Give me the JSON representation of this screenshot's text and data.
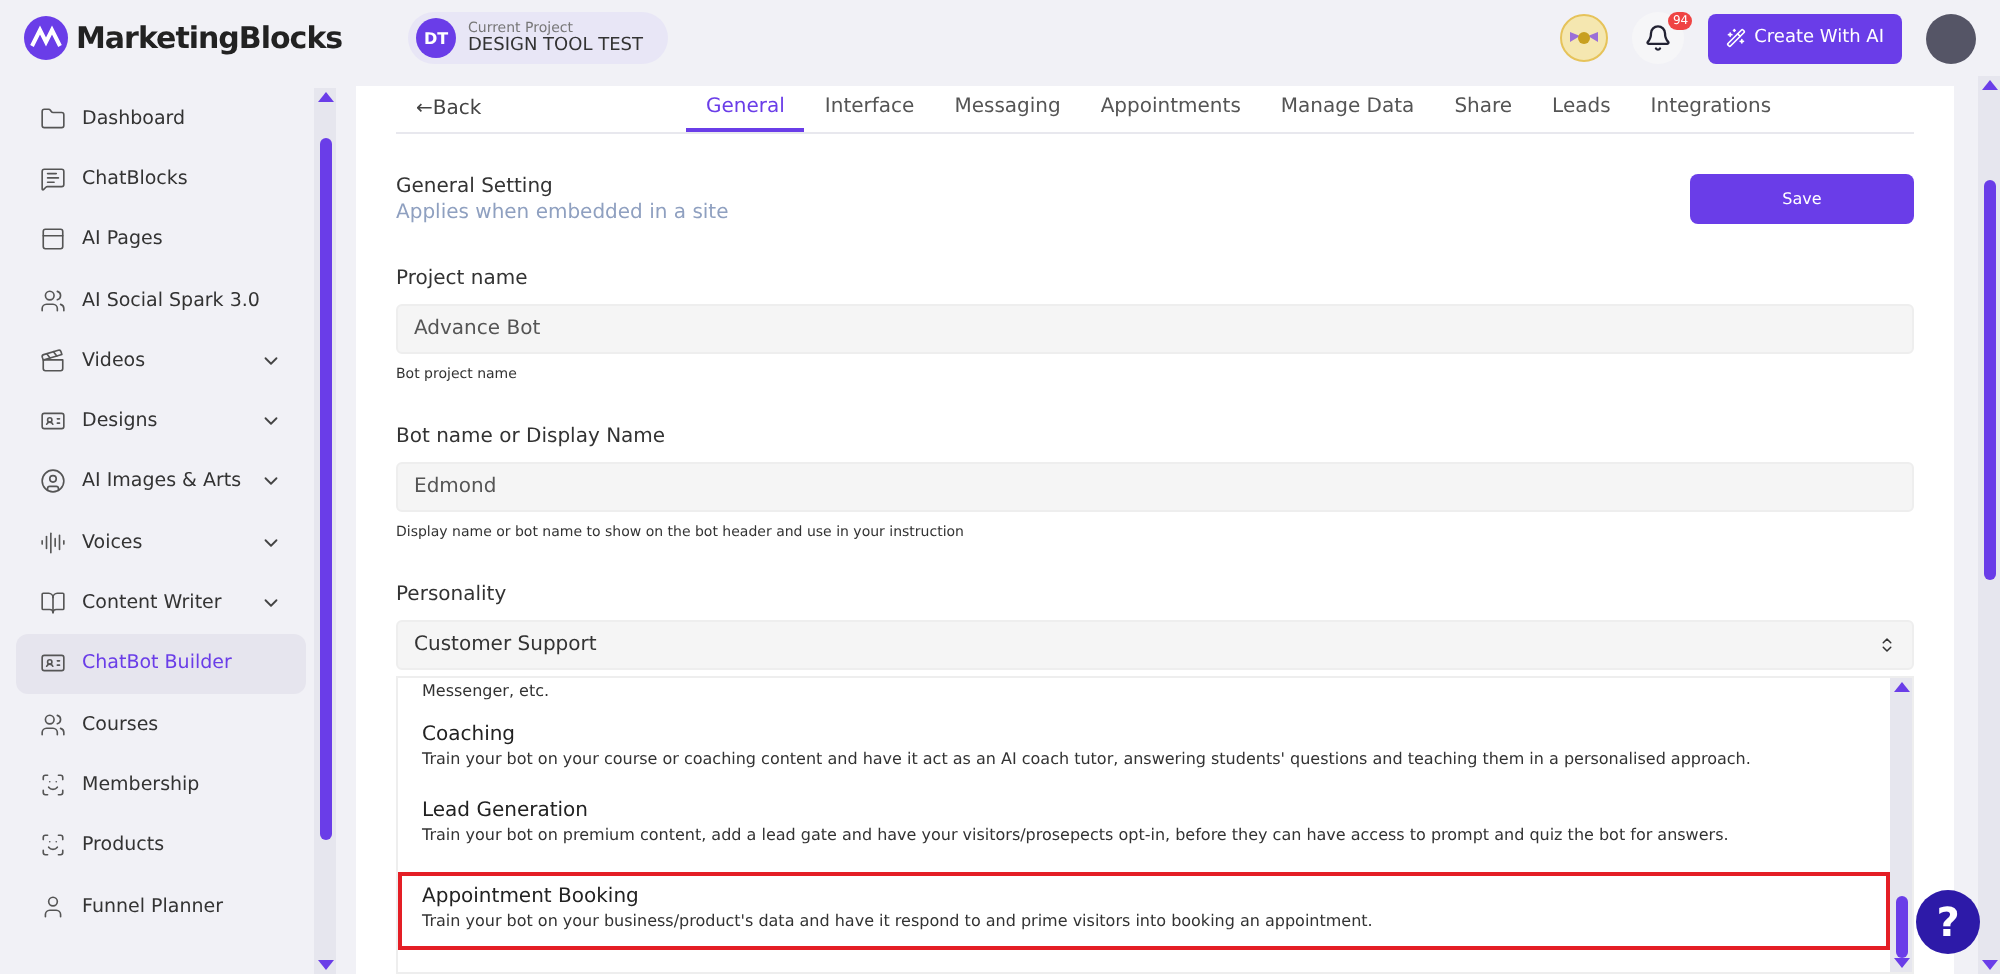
{
  "header": {
    "logo": "MarketingBlocks",
    "project": {
      "initials": "DT",
      "caption": "Current Project",
      "name": "DESIGN TOOL TEST"
    },
    "notifications": "94",
    "create_button": "Create With AI"
  },
  "sidebar": {
    "items": [
      {
        "label": "Dashboard",
        "expandable": false,
        "selected": false
      },
      {
        "label": "ChatBlocks",
        "expandable": false,
        "selected": false
      },
      {
        "label": "AI Pages",
        "expandable": false,
        "selected": false
      },
      {
        "label": "AI Social Spark 3.0",
        "expandable": false,
        "selected": false
      },
      {
        "label": "Videos",
        "expandable": true,
        "selected": false
      },
      {
        "label": "Designs",
        "expandable": true,
        "selected": false
      },
      {
        "label": "AI Images & Arts",
        "expandable": true,
        "selected": false
      },
      {
        "label": "Voices",
        "expandable": true,
        "selected": false
      },
      {
        "label": "Content Writer",
        "expandable": true,
        "selected": false
      },
      {
        "label": "ChatBot Builder",
        "expandable": false,
        "selected": true
      },
      {
        "label": "Courses",
        "expandable": false,
        "selected": false
      },
      {
        "label": "Membership",
        "expandable": false,
        "selected": false
      },
      {
        "label": "Products",
        "expandable": false,
        "selected": false
      },
      {
        "label": "Funnel Planner",
        "expandable": false,
        "selected": false
      }
    ]
  },
  "back": "←Back",
  "tabs": [
    {
      "label": "General",
      "selected": true
    },
    {
      "label": "Interface",
      "selected": false
    },
    {
      "label": "Messaging",
      "selected": false
    },
    {
      "label": "Appointments",
      "selected": false
    },
    {
      "label": "Manage Data",
      "selected": false
    },
    {
      "label": "Share",
      "selected": false
    },
    {
      "label": "Leads",
      "selected": false
    },
    {
      "label": "Integrations",
      "selected": false
    }
  ],
  "section": {
    "title": "General Setting",
    "subtitle": "Applies when embedded in a site",
    "save_button": "Save"
  },
  "fields": [
    {
      "label": "Project name",
      "value": "Advance Bot",
      "hint": "Bot project name"
    },
    {
      "label": "Bot name or Display Name",
      "value": "Edmond",
      "hint": "Display name or bot name to show on the bot header and use in your instruction"
    }
  ],
  "personality": {
    "label": "Personality",
    "value": "Customer Support",
    "options": [
      {
        "description": "Messenger, etc.",
        "selected": false
      },
      {
        "title": "Coaching",
        "description": "Train your bot on your course or coaching content and have it act as an AI coach tutor, answering students' questions and teaching them in a personalised approach.",
        "selected": false
      },
      {
        "title": "Lead Generation",
        "description": "Train your bot on premium content, add a lead gate and have your visitors/prosepects opt-in, before they can have access to prompt and quiz the bot for answers.",
        "selected": false
      },
      {
        "title": "Appointment Booking",
        "description": "Train your bot on your business/product's data and have it respond to and prime visitors into booking an appointment.",
        "selected": true
      }
    ]
  },
  "help_button": "?"
}
